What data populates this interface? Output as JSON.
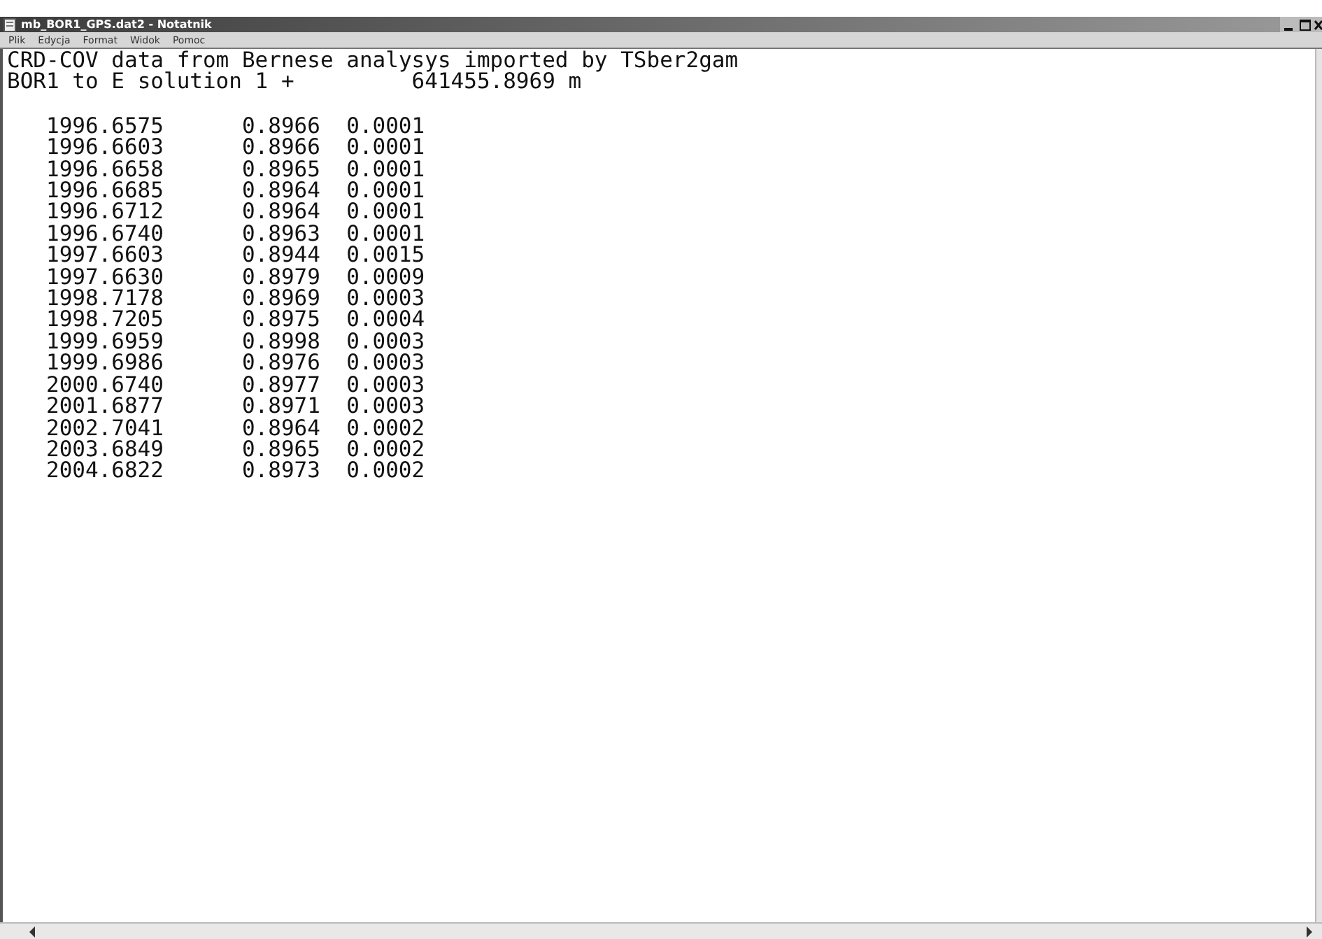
{
  "window": {
    "title": "mb_BOR1_GPS.dat2 - Notatnik"
  },
  "menu": [
    "Plik",
    "Edycja",
    "Format",
    "Widok",
    "Pomoc"
  ],
  "header": {
    "line_1": "CRD-COV data from Bernese analysys imported by TSber2gam",
    "line_2_label": "BOR1 to E solution 1 +",
    "line_2_value": "641455.8969 m"
  },
  "rows": [
    [
      "1996.6575",
      "0.8966",
      "0.0001"
    ],
    [
      "1996.6603",
      "0.8966",
      "0.0001"
    ],
    [
      "1996.6658",
      "0.8965",
      "0.0001"
    ],
    [
      "1996.6685",
      "0.8964",
      "0.0001"
    ],
    [
      "1996.6712",
      "0.8964",
      "0.0001"
    ],
    [
      "1996.6740",
      "0.8963",
      "0.0001"
    ],
    [
      "1997.6603",
      "0.8944",
      "0.0015"
    ],
    [
      "1997.6630",
      "0.8979",
      "0.0009"
    ],
    [
      "1998.7178",
      "0.8969",
      "0.0003"
    ],
    [
      "1998.7205",
      "0.8975",
      "0.0004"
    ],
    [
      "1999.6959",
      "0.8998",
      "0.0003"
    ],
    [
      "1999.6986",
      "0.8976",
      "0.0003"
    ],
    [
      "2000.6740",
      "0.8977",
      "0.0003"
    ],
    [
      "2001.6877",
      "0.8971",
      "0.0003"
    ],
    [
      "2002.7041",
      "0.8964",
      "0.0002"
    ],
    [
      "2003.6849",
      "0.8965",
      "0.0002"
    ],
    [
      "2004.6822",
      "0.8973",
      "0.0002"
    ]
  ]
}
